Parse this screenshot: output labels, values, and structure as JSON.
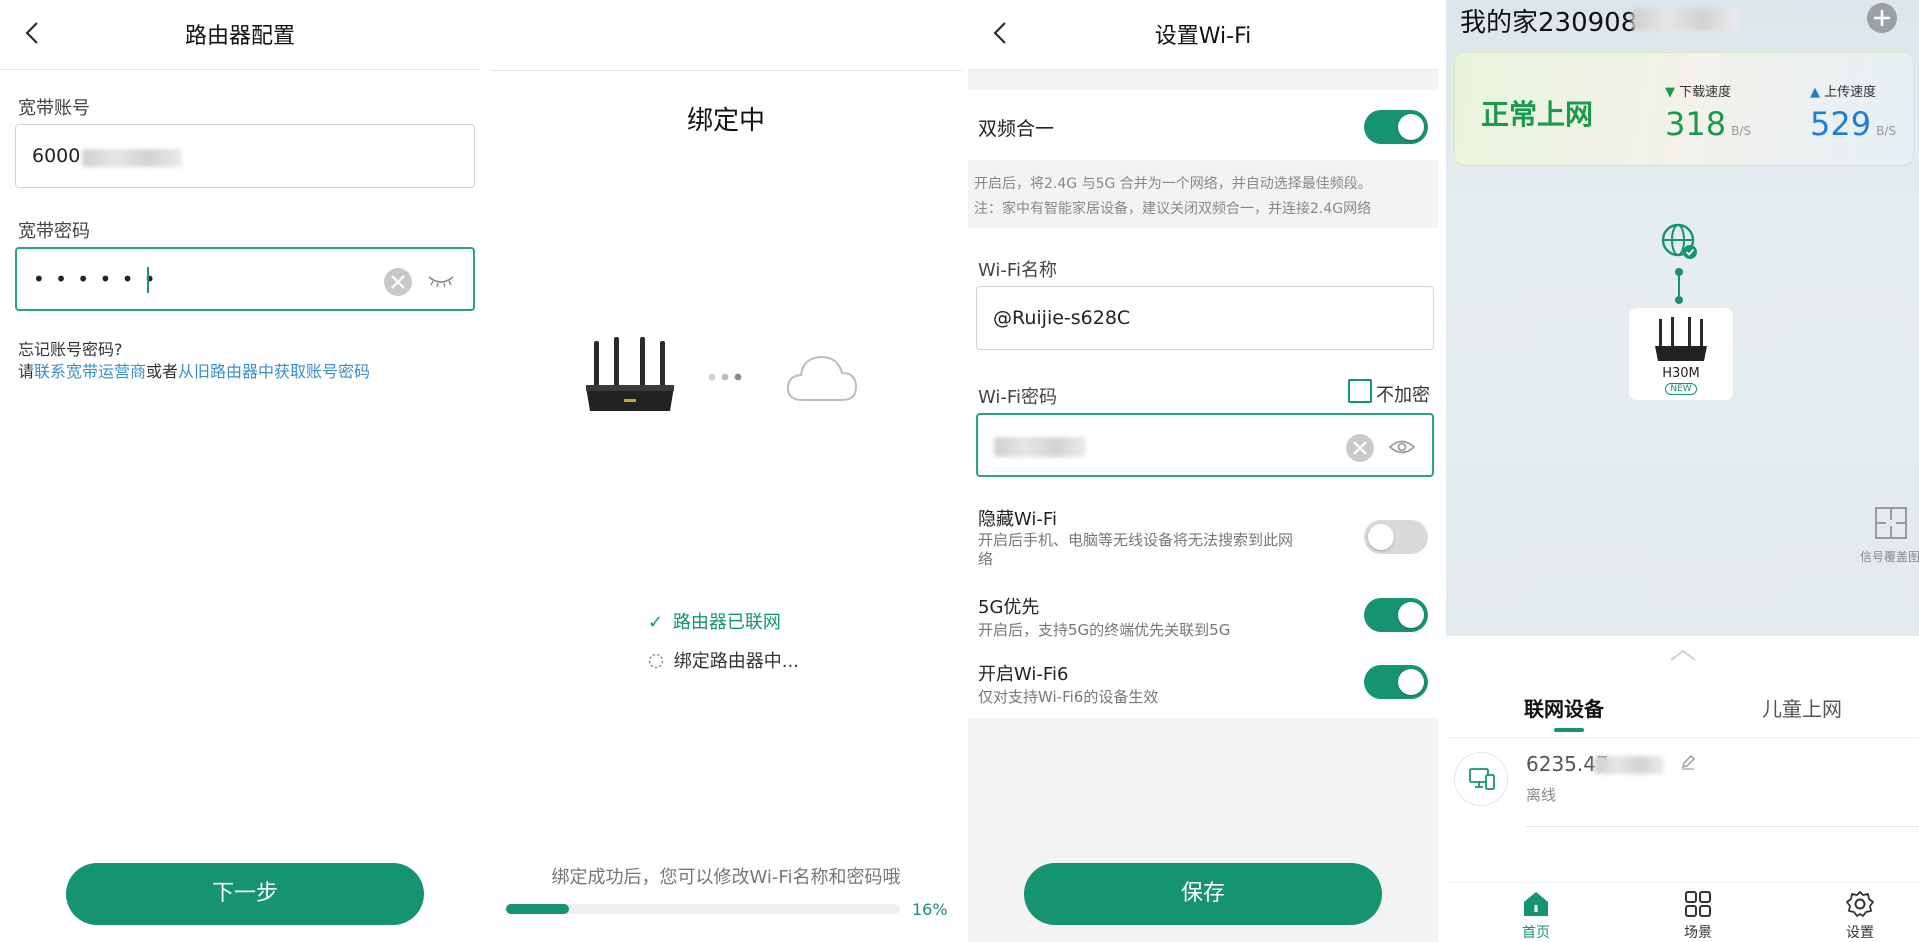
{
  "panel1": {
    "title": "路由器配置",
    "account_label": "宽带账号",
    "account_value": "6000",
    "password_label": "宽带密码",
    "password_value": "• • • • • •",
    "forgot_line1": "忘记账号密码?",
    "forgot_prefix": "请",
    "forgot_link1": "联系宽带运营商",
    "forgot_mid": "或者",
    "forgot_link2": "从旧路由器中获取账号密码",
    "next_button": "下一步"
  },
  "panel2": {
    "title": "绑定中",
    "status_done": "路由器已联网",
    "status_pending": "绑定路由器中...",
    "hint": "绑定成功后，您可以修改Wi-Fi名称和密码哦",
    "progress_text": "16%",
    "progress_value": 0.16
  },
  "panel3": {
    "title": "设置Wi-Fi",
    "dual_band_label": "双频合一",
    "dual_band_desc1": "开启后，将2.4G 与5G 合并为一个网络，并自动选择最佳频段。",
    "dual_band_desc2": "注：家中有智能家居设备，建议关闭双频合一，并连接2.4G网络",
    "wifi_name_label": "Wi-Fi名称",
    "wifi_name_value": "@Ruijie-s628C",
    "wifi_pwd_label": "Wi-Fi密码",
    "no_encrypt_label": "不加密",
    "hide_wifi_label": "隐藏Wi-Fi",
    "hide_wifi_desc1": "开启后手机、电脑等无线设备将无法搜索到此网",
    "hide_wifi_desc2": "络",
    "g5_label": "5G优先",
    "g5_desc": "开启后，支持5G的终端优先关联到5G",
    "wifi6_label": "开启Wi-Fi6",
    "wifi6_desc": "仅对支持Wi-Fi6的设备生效",
    "save_button": "保存",
    "toggles": {
      "dual_band": true,
      "hide_wifi": false,
      "g5": true,
      "wifi6": true
    }
  },
  "panel4": {
    "home_title": "我的家230908",
    "status": "正常上网",
    "download_label": "下载速度",
    "download_value": "318",
    "download_unit": "B/S",
    "upload_label": "上传速度",
    "upload_value": "529",
    "upload_unit": "B/S",
    "router_model": "H30M",
    "router_badge": "NEW",
    "coverage_label": "信号覆盖图",
    "tab_devices": "联网设备",
    "tab_kids": "儿童上网",
    "device_name": "6235.47",
    "device_status": "离线",
    "nav_home": "首页",
    "nav_scene": "场景",
    "nav_settings": "设置"
  },
  "colors": {
    "accent": "#16936f",
    "link": "#3a8fc9",
    "download": "#1a9a4a",
    "upload": "#1f7fd6"
  }
}
